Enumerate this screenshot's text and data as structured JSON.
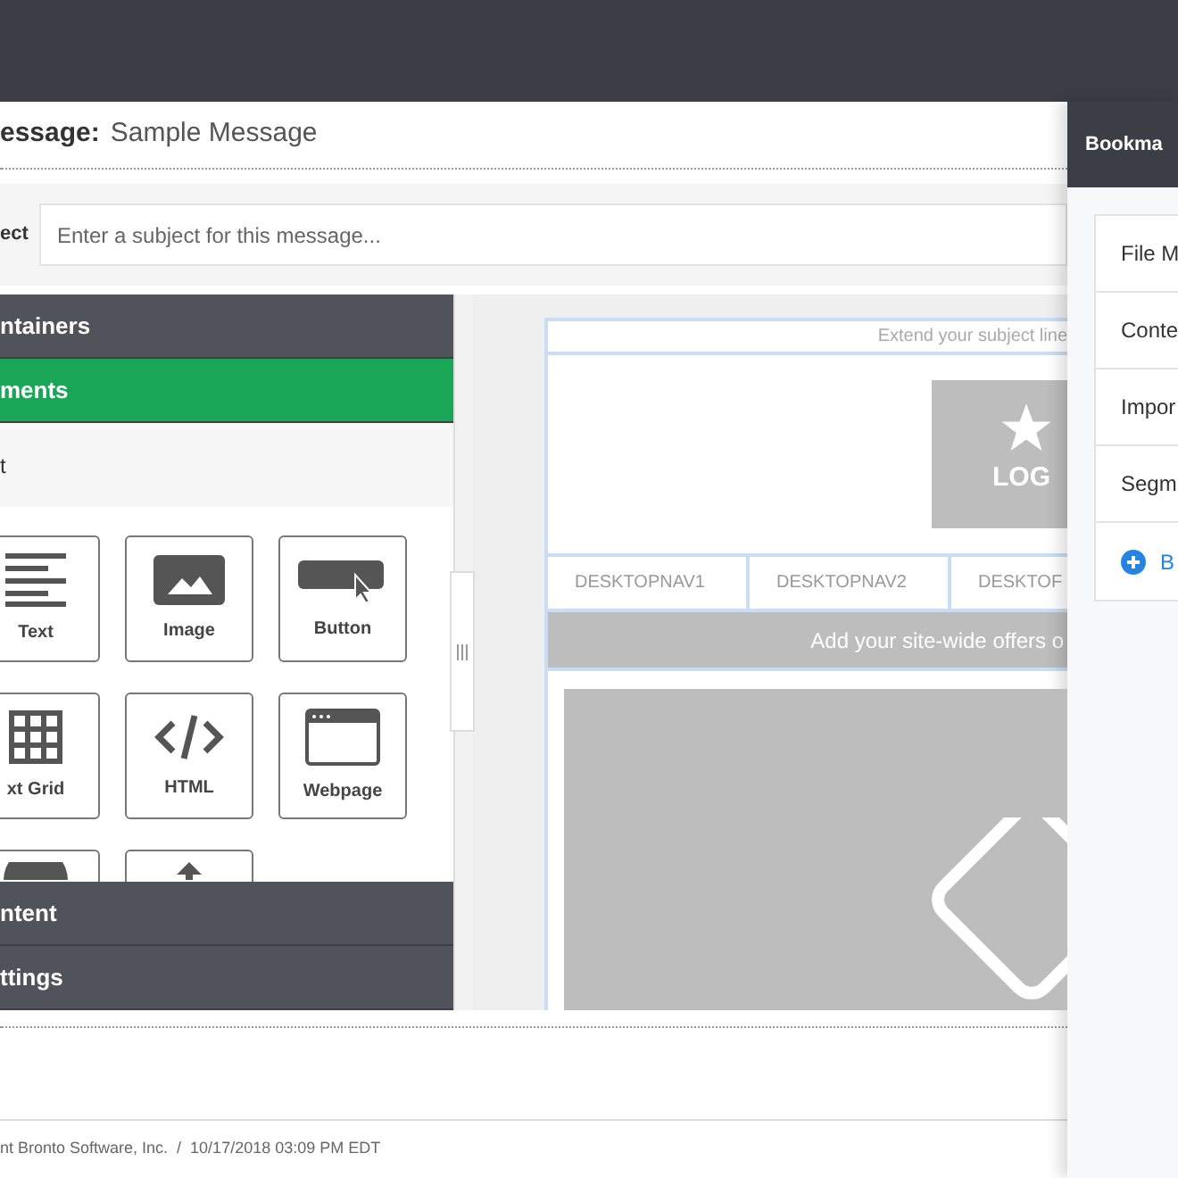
{
  "title": {
    "label": "essage:",
    "value": "Sample Message"
  },
  "subject": {
    "label": "ect",
    "placeholder": "Enter a subject for this message..."
  },
  "sidebar": {
    "sections": [
      {
        "label": "ntainers",
        "selected": false
      },
      {
        "label": "ments",
        "selected": true
      }
    ],
    "subsection": "t",
    "tiles": [
      {
        "kind": "text",
        "label": "Text"
      },
      {
        "kind": "image",
        "label": "Image"
      },
      {
        "kind": "button",
        "label": "Button"
      },
      {
        "kind": "grid",
        "label": "xt Grid"
      },
      {
        "kind": "html",
        "label": "HTML"
      },
      {
        "kind": "webpage",
        "label": "Webpage"
      },
      {
        "kind": "circle"
      },
      {
        "kind": "upload"
      }
    ],
    "footer_sections": [
      {
        "label": "ntent",
        "selected": false
      },
      {
        "label": "ttings",
        "selected": false
      }
    ]
  },
  "email": {
    "preheader": "Extend your subject line",
    "logo": "LOG",
    "nav": [
      "DESKTOPNAV1",
      "DESKTOPNAV2",
      "DESKTOF"
    ],
    "offer": "Add your site-wide offers o"
  },
  "footer": "nt Bronto Software, Inc.  /  10/17/2018 03:09 PM EDT",
  "drawer": {
    "title": "Bookma",
    "items": [
      "File M",
      "Conte",
      "Impor",
      "Segm"
    ],
    "add": "B"
  }
}
